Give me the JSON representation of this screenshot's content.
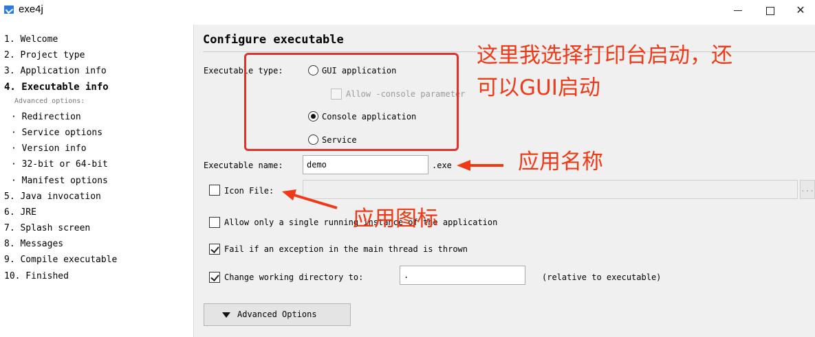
{
  "window": {
    "title": "exe4j"
  },
  "steps": {
    "items": [
      "1. Welcome",
      "2. Project type",
      "3. Application info",
      "4. Executable info"
    ],
    "advanced_label": "Advanced options:",
    "advanced_items": [
      "· Redirection",
      "· Service options",
      "· Version info",
      "· 32-bit or 64-bit",
      "· Manifest options"
    ],
    "later_items": [
      "5. Java invocation",
      "6. JRE",
      "7. Splash screen",
      "8. Messages",
      "9. Compile executable",
      "10. Finished"
    ]
  },
  "panel": {
    "title": "Configure executable",
    "executable_type_label": "Executable type:",
    "types": {
      "gui": "GUI application",
      "allow_console": "Allow -console parameter",
      "console": "Console application",
      "service": "Service"
    },
    "executable_name_label": "Executable name:",
    "executable_name_value": "demo",
    "exe_suffix": ".exe",
    "icon_file_label": "Icon File:",
    "icon_browse": "...",
    "single_instance_label": "Allow only a single running instance of the application",
    "fail_exception_label": "Fail if an exception in the main thread is thrown",
    "change_dir_label": "Change working directory to:",
    "change_dir_value": ".",
    "change_dir_note": "(relative to executable)",
    "advanced_button": "Advanced Options"
  },
  "annotations": {
    "launch_note_line1": "这里我选择打印台启动，还",
    "launch_note_line2": "可以GUI启动",
    "app_name_note": "应用名称",
    "app_icon_note": "应用图标"
  },
  "colors": {
    "annotation": "#f03a17",
    "highlight_box": "#e4302b"
  },
  "state": {
    "selected_type": "console",
    "allow_console_checked": false,
    "icon_file_checked": false,
    "single_instance_checked": false,
    "fail_exception_checked": true,
    "change_dir_checked": true
  }
}
